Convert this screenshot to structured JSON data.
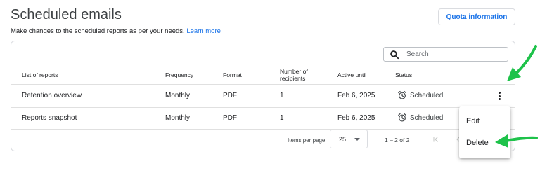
{
  "header": {
    "title": "Scheduled emails",
    "subtitle": "Make changes to the scheduled reports as per your needs.",
    "learn_more": "Learn more",
    "quota_button": "Quota information"
  },
  "search": {
    "placeholder": "Search"
  },
  "table": {
    "columns": {
      "list_of_reports": "List of reports",
      "frequency": "Frequency",
      "format": "Format",
      "recipients_line1": "Number of",
      "recipients_line2": "recipients",
      "active_until": "Active until",
      "status": "Status"
    },
    "rows": [
      {
        "name": "Retention overview",
        "frequency": "Monthly",
        "format": "PDF",
        "recipients": "1",
        "active_until": "Feb 6, 2025",
        "status": "Scheduled"
      },
      {
        "name": "Reports snapshot",
        "frequency": "Monthly",
        "format": "PDF",
        "recipients": "1",
        "active_until": "Feb 6, 2025",
        "status": "Scheduled"
      }
    ]
  },
  "pagination": {
    "items_per_page_label": "Items per page:",
    "items_per_page_value": "25",
    "range": "1 – 2 of 2"
  },
  "menu": {
    "edit": "Edit",
    "delete": "Delete"
  },
  "colors": {
    "accent": "#1a73e8",
    "annotation_arrow": "#1ec24a"
  }
}
